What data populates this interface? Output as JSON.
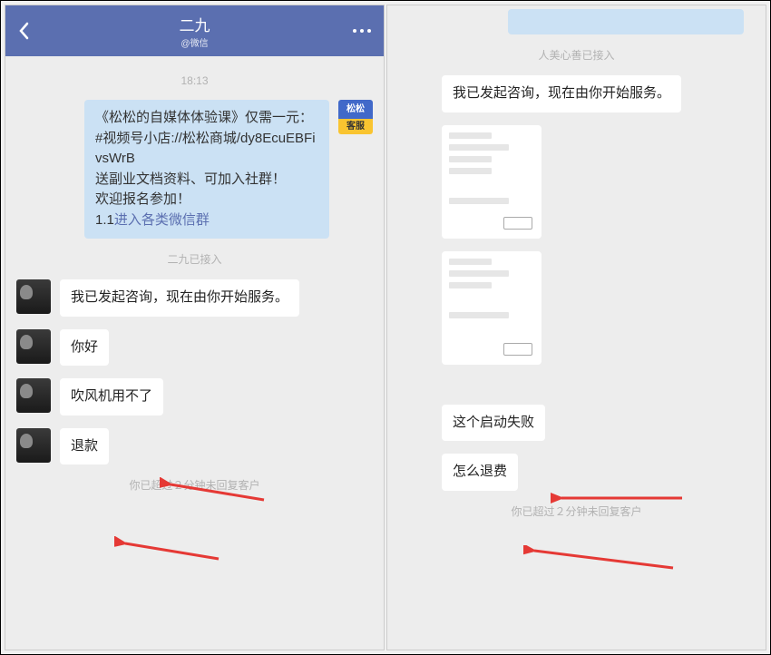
{
  "left": {
    "header": {
      "title": "二九",
      "subtitle": "@微信"
    },
    "timestamp": "18:13",
    "service_badge": {
      "top": "松松",
      "bottom": "客服"
    },
    "service_msg": {
      "line1": "《松松的自媒体体验课》仅需一元：",
      "line2": "#视频号小店://松松商城/dy8EcuEBFivsWrB",
      "line3": "送副业文档资料、可加入社群！",
      "line4": "欢迎报名参加！",
      "link_prefix": "1.1",
      "link_text": "进入各类微信群"
    },
    "status_connected": "二九已接入",
    "msgs": {
      "m1": "我已发起咨询，现在由你开始服务。",
      "m2": "你好",
      "m3": "吹风机用不了",
      "m4": "退款"
    },
    "footer_warn": "你已超过２分钟未回复客户"
  },
  "right": {
    "status_connected": "人美心善已接入",
    "msgs": {
      "m1": "我已发起咨询，现在由你开始服务。",
      "m2": "这个启动失败",
      "m3": "怎么退费"
    },
    "footer_warn": "你已超过２分钟未回复客户"
  }
}
